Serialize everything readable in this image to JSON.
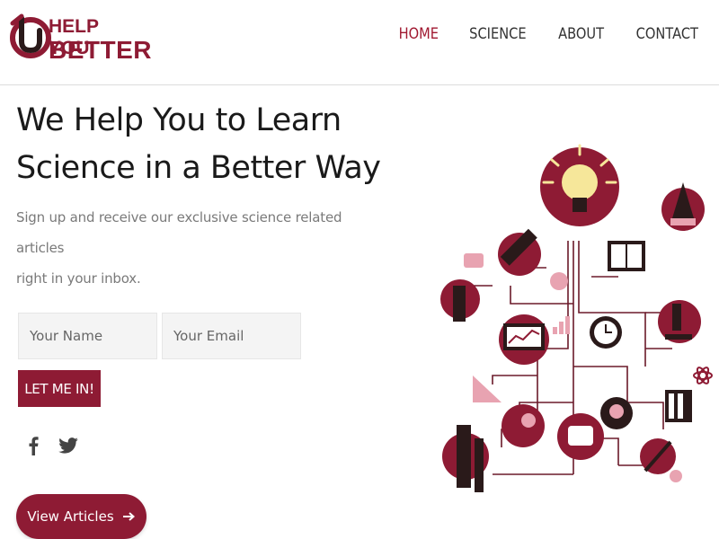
{
  "brand": {
    "line1": "HELP YOU",
    "line2": "BETTER",
    "color": "#8e1b34"
  },
  "nav": {
    "items": [
      {
        "label": "HOME",
        "active": true
      },
      {
        "label": "SCIENCE",
        "active": false
      },
      {
        "label": "ABOUT",
        "active": false
      },
      {
        "label": "CONTACT",
        "active": false
      }
    ],
    "active_color": "#a01830"
  },
  "hero": {
    "title_line1": "We Help You to Learn",
    "title_line2": "Science in a Better Way",
    "subtitle_line1": "Sign up and receive our exclusive science related articles",
    "subtitle_line2": "right in your inbox."
  },
  "form": {
    "name_placeholder": "Your Name",
    "email_placeholder": "Your Email",
    "submit_label": "LET ME IN!"
  },
  "social": {
    "icons": [
      "facebook-icon",
      "twitter-icon"
    ]
  },
  "articles_button": {
    "label": "View Articles",
    "icon": "arrow-right-icon"
  },
  "illustration": {
    "icon": "science-network-illustration",
    "colors": {
      "primary": "#8e1b34",
      "secondary": "#e8a3b1",
      "dark": "#2a1a1a",
      "bulb": "#f6e79a"
    }
  }
}
